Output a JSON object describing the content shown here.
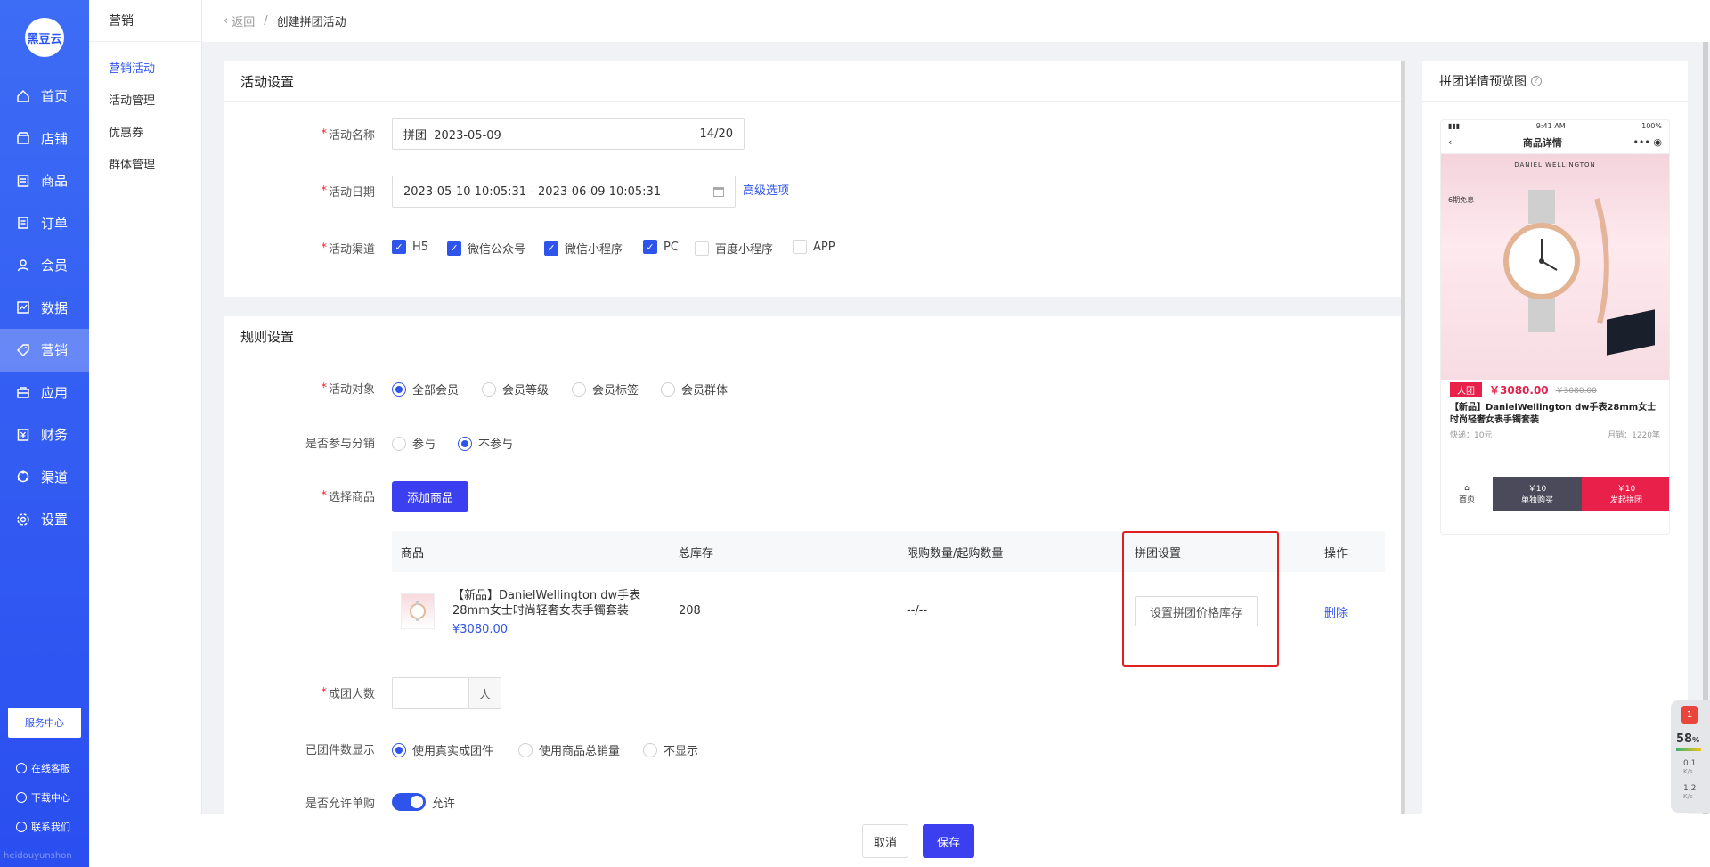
{
  "brand": {
    "logo_text": "黑豆云",
    "watermark": "heidouyunshon"
  },
  "sidebar": {
    "items": [
      {
        "label": "首页",
        "icon": "home-icon"
      },
      {
        "label": "店铺",
        "icon": "shop-icon"
      },
      {
        "label": "商品",
        "icon": "goods-icon"
      },
      {
        "label": "订单",
        "icon": "order-icon"
      },
      {
        "label": "会员",
        "icon": "user-icon"
      },
      {
        "label": "数据",
        "icon": "chart-icon"
      },
      {
        "label": "营销",
        "icon": "tag-icon"
      },
      {
        "label": "应用",
        "icon": "app-icon"
      },
      {
        "label": "财务",
        "icon": "finance-icon"
      },
      {
        "label": "渠道",
        "icon": "channel-icon"
      },
      {
        "label": "设置",
        "icon": "gear-icon"
      }
    ],
    "service_center": "服务中心",
    "links": [
      "在线客服",
      "下载中心",
      "联系我们"
    ]
  },
  "subnav": {
    "title": "营销",
    "items": [
      "营销活动",
      "活动管理",
      "优惠券",
      "群体管理"
    ]
  },
  "topbar": {
    "back": "返回",
    "separator": "/",
    "current": "创建拼团活动"
  },
  "activity": {
    "title": "活动设置",
    "name_label": "活动名称",
    "name_value": "拼团  2023-05-09",
    "name_count": "14/20",
    "date_label": "活动日期",
    "date_value": "2023-05-10 10:05:31 - 2023-06-09 10:05:31",
    "advanced": "高级选项",
    "channel_label": "活动渠道",
    "channels": [
      {
        "label": "H5",
        "checked": true
      },
      {
        "label": "微信公众号",
        "checked": true
      },
      {
        "label": "微信小程序",
        "checked": true
      },
      {
        "label": "PC",
        "checked": true
      },
      {
        "label": "百度小程序",
        "checked": false
      },
      {
        "label": "APP",
        "checked": false
      }
    ]
  },
  "rules": {
    "title": "规则设置",
    "target_label": "活动对象",
    "targets": [
      "全部会员",
      "会员等级",
      "会员标签",
      "会员群体"
    ],
    "dist_label": "是否参与分销",
    "dist": [
      "参与",
      "不参与"
    ],
    "goods_label": "选择商品",
    "add_goods": "添加商品",
    "columns": [
      "商品",
      "总库存",
      "限购数量/起购数量",
      "拼团设置",
      "操作"
    ],
    "row": {
      "name": "【新品】DanielWellington dw手表 28mm女士时尚轻奢女表手镯套装",
      "price": "¥3080.00",
      "stock": "208",
      "limit": "--/--",
      "setting": "设置拼团价格库存",
      "action": "删除"
    },
    "group_label": "成团人数",
    "group_unit": "人",
    "shown_label": "已团件数显示",
    "shown": [
      "使用真实成团件",
      "使用商品总销量",
      "不显示"
    ],
    "single_label": "是否允许单购",
    "single_text": "允许"
  },
  "preview": {
    "title": "拼团详情预览图",
    "status_time": "9:41 AM",
    "status_batt": "100%",
    "page_title": "商品详情",
    "brand_banner": "DANIEL WELLINGTON",
    "promo_tag": "6期免息",
    "badge": "人团",
    "price": "￥3080.00",
    "old_price": "￥3080.00",
    "product": "【新品】DanielWellington dw手表28mm女士时尚轻奢女表手镯套装",
    "ship": "快递：10元",
    "sales": "月销：1220笔",
    "home": "首页",
    "buy_price": "￥10",
    "buy_label": "单独购买",
    "group_price": "￥10",
    "group_buy": "发起拼团"
  },
  "monitor": {
    "badge": "1",
    "cpu": "58",
    "up": "0.1",
    "down": "1.2",
    "unit": "K/s"
  },
  "footer": {
    "cancel": "取消",
    "save": "保存"
  }
}
